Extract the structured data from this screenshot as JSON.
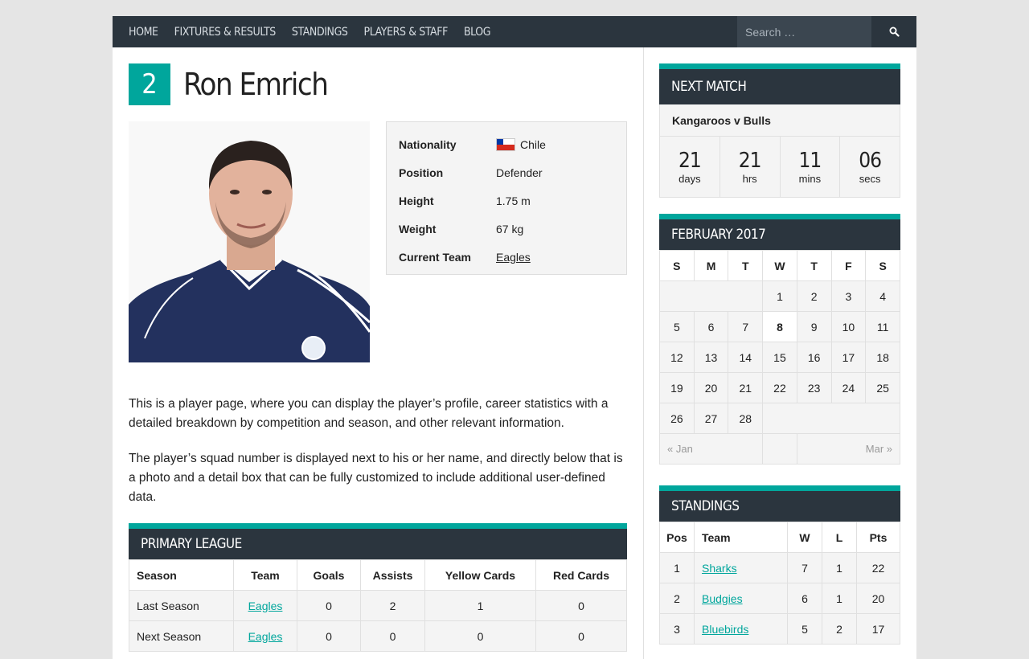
{
  "nav": {
    "items": [
      "HOME",
      "FIXTURES & RESULTS",
      "STANDINGS",
      "PLAYERS & STAFF",
      "BLOG"
    ],
    "search_placeholder": "Search …"
  },
  "player": {
    "number": "2",
    "name": "Ron Emrich",
    "details": [
      {
        "label": "Nationality",
        "value": "Chile"
      },
      {
        "label": "Position",
        "value": "Defender"
      },
      {
        "label": "Height",
        "value": "1.75 m"
      },
      {
        "label": "Weight",
        "value": "67 kg"
      },
      {
        "label": "Current Team",
        "value": "Eagles"
      }
    ],
    "paragraphs": [
      "This is a player page, where you can display the player’s profile, career statistics with a detailed breakdown by competition and season, and other relevant information.",
      "The player’s squad number is displayed next to his or her name, and directly below that is a photo and a detail box that can be fully customized to include additional user-defined data."
    ]
  },
  "league": {
    "title": "PRIMARY LEAGUE",
    "columns": [
      "Season",
      "Team",
      "Goals",
      "Assists",
      "Yellow Cards",
      "Red Cards"
    ],
    "rows": [
      [
        "Last Season",
        "Eagles",
        "0",
        "2",
        "1",
        "0"
      ],
      [
        "Next Season",
        "Eagles",
        "0",
        "0",
        "0",
        "0"
      ]
    ]
  },
  "next_match": {
    "title": "NEXT MATCH",
    "match": "Kangaroos v Bulls",
    "countdown": [
      {
        "n": "21",
        "u": "days"
      },
      {
        "n": "21",
        "u": "hrs"
      },
      {
        "n": "11",
        "u": "mins"
      },
      {
        "n": "06",
        "u": "secs"
      }
    ]
  },
  "calendar": {
    "title": "FEBRUARY 2017",
    "days": [
      "S",
      "M",
      "T",
      "W",
      "T",
      "F",
      "S"
    ],
    "weeks": [
      [
        "",
        "",
        "",
        "1",
        "2",
        "3",
        "4"
      ],
      [
        "5",
        "6",
        "7",
        "8",
        "9",
        "10",
        "11"
      ],
      [
        "12",
        "13",
        "14",
        "15",
        "16",
        "17",
        "18"
      ],
      [
        "19",
        "20",
        "21",
        "22",
        "23",
        "24",
        "25"
      ],
      [
        "26",
        "27",
        "28",
        "",
        "",
        "",
        ""
      ]
    ],
    "today": "8",
    "prev": "« Jan",
    "next": "Mar »"
  },
  "standings": {
    "title": "STANDINGS",
    "columns": [
      "Pos",
      "Team",
      "W",
      "L",
      "Pts"
    ],
    "rows": [
      [
        "1",
        "Sharks",
        "7",
        "1",
        "22"
      ],
      [
        "2",
        "Budgies",
        "6",
        "1",
        "20"
      ],
      [
        "3",
        "Bluebirds",
        "5",
        "2",
        "17"
      ]
    ]
  },
  "colors": {
    "accent": "#00a69c",
    "header": "#2b353e"
  }
}
